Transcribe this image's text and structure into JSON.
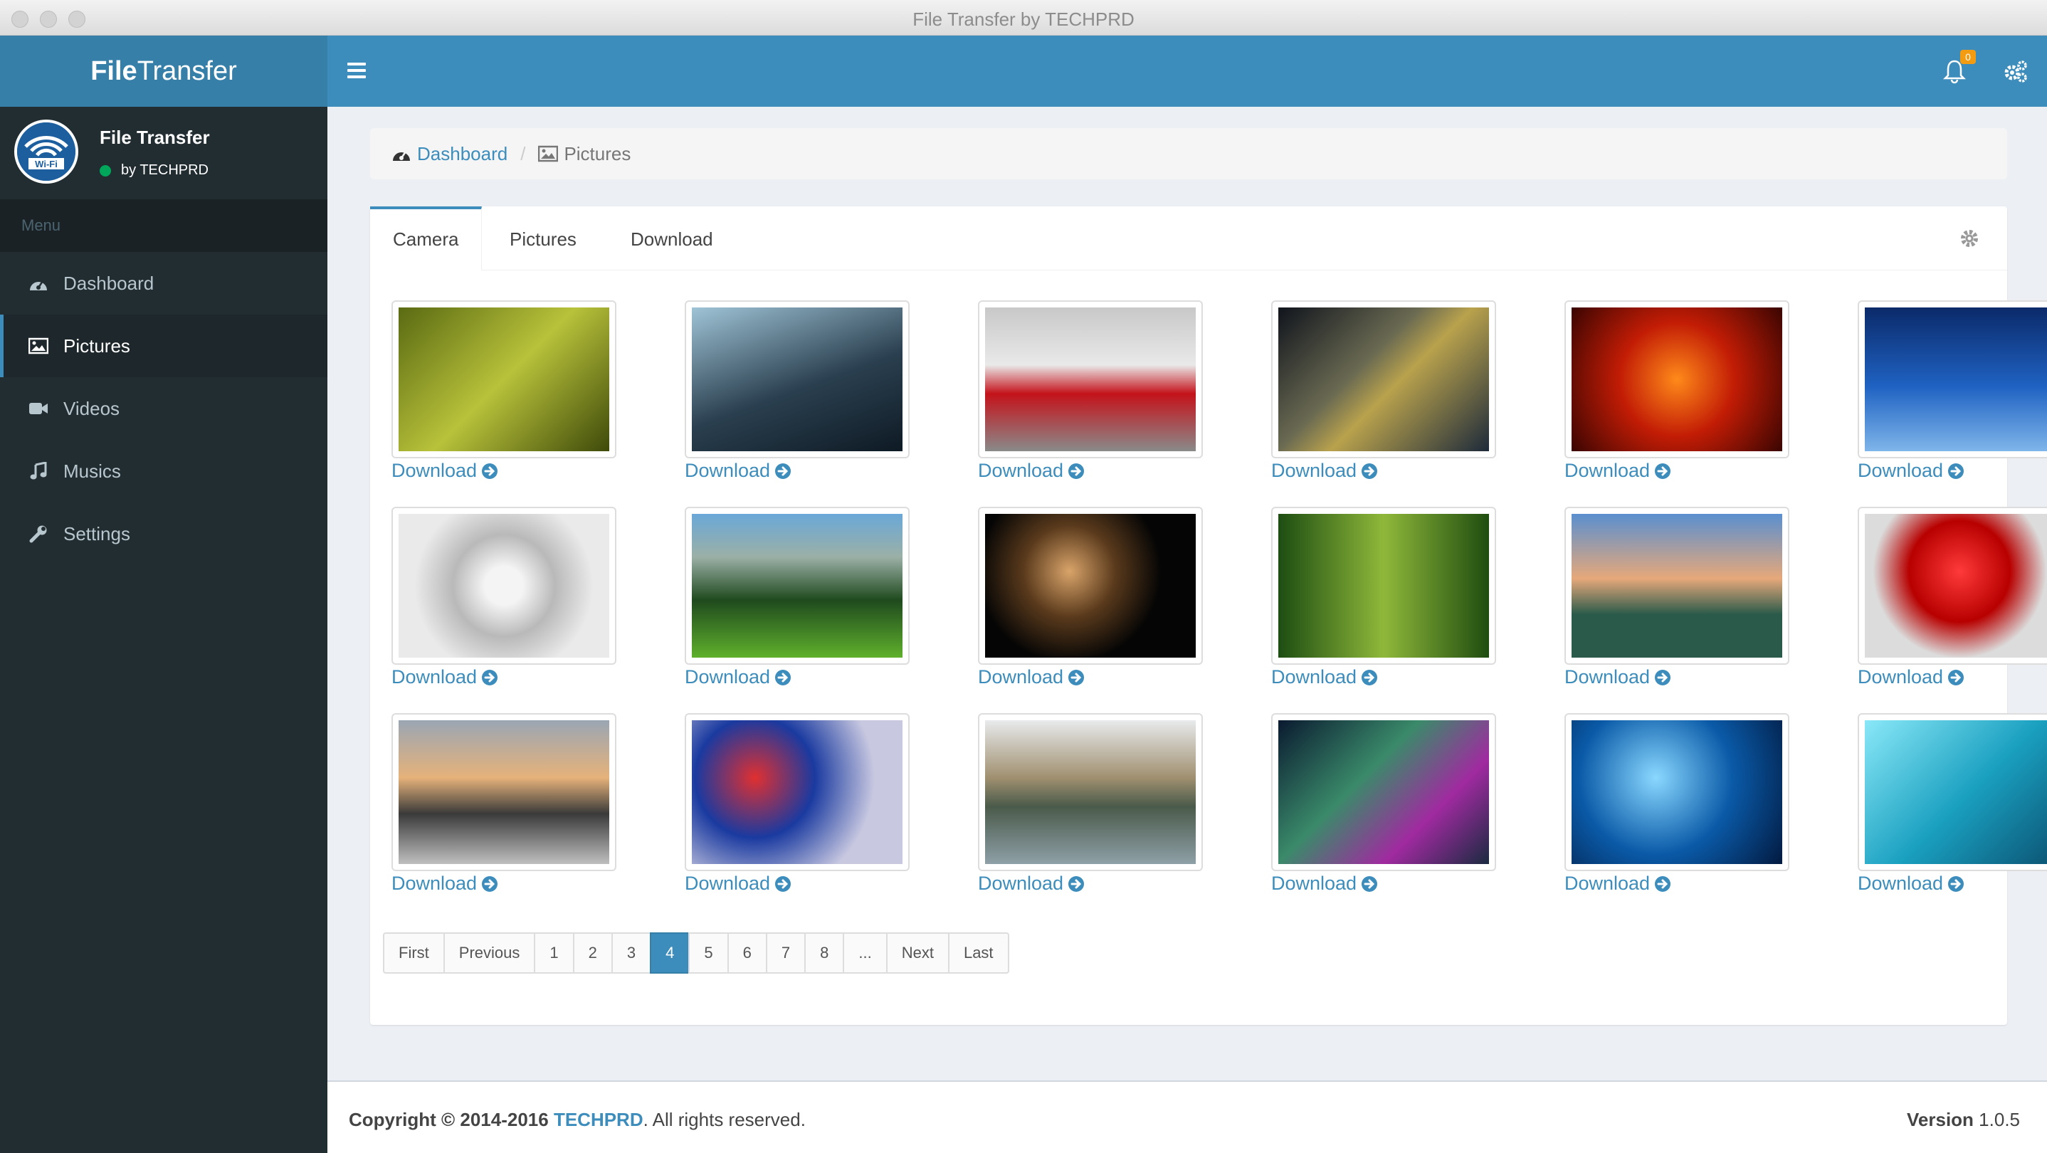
{
  "window": {
    "title": "File Transfer by TECHPRD"
  },
  "sidebar": {
    "logo_bold": "File",
    "logo_light": "Transfer",
    "app_name": "File Transfer",
    "app_subtitle": "by TECHPRD",
    "avatar_text": "Wi-Fi",
    "menu_header": "Menu",
    "items": [
      {
        "label": "Dashboard",
        "icon": "dashboard-icon"
      },
      {
        "label": "Pictures",
        "icon": "picture-icon",
        "active": true
      },
      {
        "label": "Videos",
        "icon": "video-camera-icon"
      },
      {
        "label": "Musics",
        "icon": "music-icon"
      },
      {
        "label": "Settings",
        "icon": "wrench-icon"
      }
    ]
  },
  "header": {
    "notification_count": "0"
  },
  "breadcrumb": {
    "home": "Dashboard",
    "current": "Pictures"
  },
  "tabs": [
    {
      "label": "Camera",
      "active": true
    },
    {
      "label": "Pictures"
    },
    {
      "label": "Download"
    }
  ],
  "gallery": {
    "download_label": "Download",
    "count": 18
  },
  "pagination": [
    "First",
    "Previous",
    "1",
    "2",
    "3",
    "4",
    "5",
    "6",
    "7",
    "8",
    "...",
    "Next",
    "Last"
  ],
  "pagination_active": "4",
  "footer": {
    "copyright": "Copyright © 2014-2016 ",
    "company": "TECHPRD",
    "rights": ". All rights reserved.",
    "version_label": "Version",
    "version": "1.0.5"
  },
  "colors": {
    "primary": "#3c8dbc",
    "sidebar": "#222d32",
    "badge": "#f39c12",
    "online": "#00a65a"
  }
}
